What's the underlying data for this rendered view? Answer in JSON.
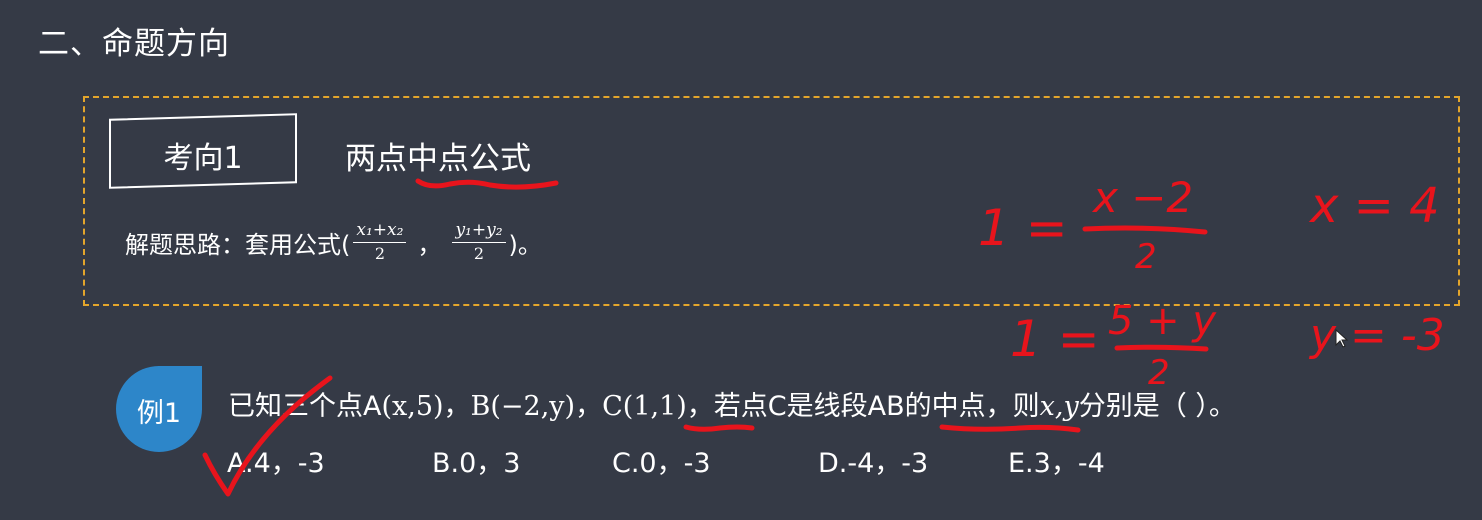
{
  "section": {
    "title": "二、命题方向"
  },
  "point": {
    "tag": "考向1",
    "title": "两点中点公式",
    "method_prefix": "解题思路：套用公式(",
    "frac1_num": "x₁+x₂",
    "frac1_den": "2",
    "separator": "，",
    "frac2_num": "y₁+y₂",
    "frac2_den": "2",
    "method_suffix": ")。"
  },
  "example": {
    "badge": "例1",
    "q_part1": "已知三个点A",
    "q_pointA": "(x,5)",
    "q_sep1": "，",
    "q_pointB_label": "B",
    "q_pointB": "(−2,y)",
    "q_sep2": "，",
    "q_pointC_label": "C",
    "q_pointC": "(1,1)",
    "q_part2": "，若点C是线段AB的中点，则",
    "q_vars": "x,y",
    "q_part3": "分别是（    ）。",
    "options": [
      "A.4，-3",
      "B.0，3",
      "C.0，-3",
      "D.-4，-3",
      "E.3，-4"
    ]
  },
  "handwriting": {
    "eq1_lhs": "1 =",
    "eq1_num": "x −2",
    "eq1_den": "2",
    "eq1_result": "x = 4",
    "eq2_lhs": "1 =",
    "eq2_num": "5 + y",
    "eq2_den": "2",
    "eq2_result": "y = -3"
  },
  "colors": {
    "background": "#353a46",
    "dashed_border": "#e3a52b",
    "badge": "#2d86c9",
    "ink": "#e8141c"
  }
}
